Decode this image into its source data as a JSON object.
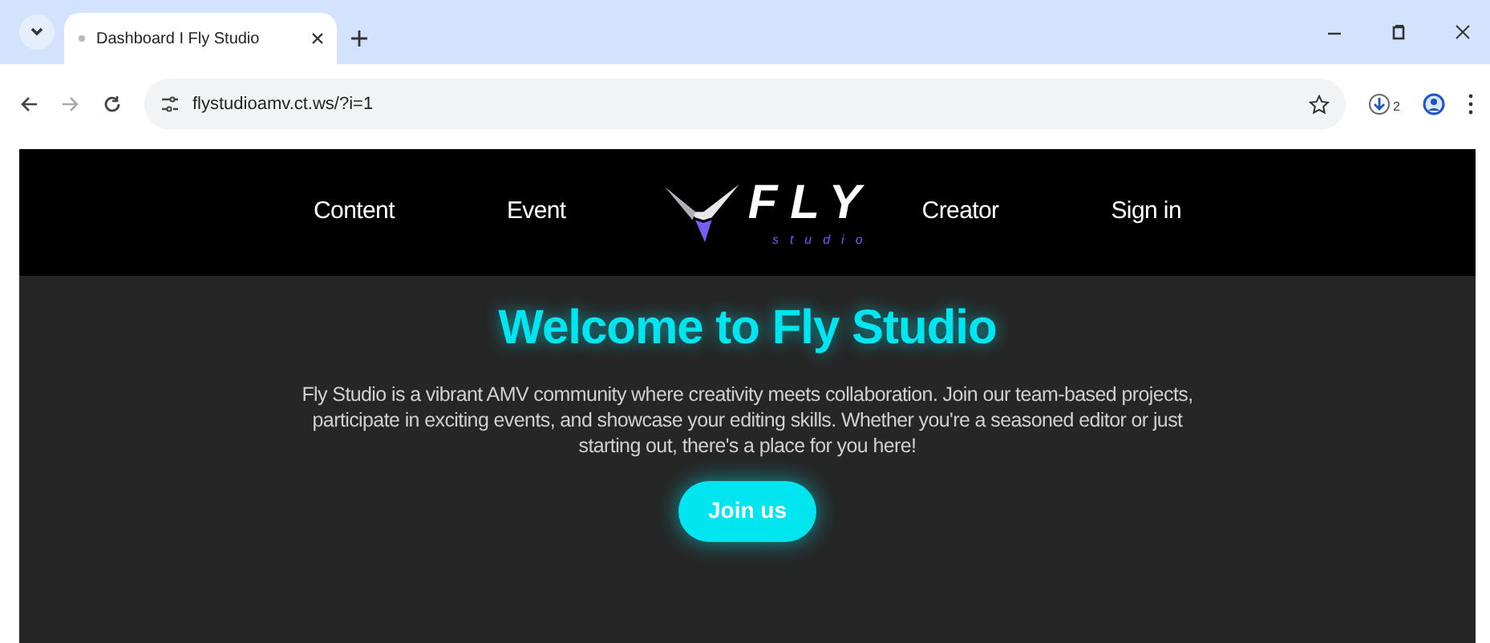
{
  "browser": {
    "tab": {
      "title": "Dashboard I Fly Studio",
      "selected": true
    },
    "url": "flystudioamv.ct.ws/?i=1",
    "downloads_badge": "2"
  },
  "nav": {
    "left": [
      "Content",
      "Event"
    ],
    "logo": {
      "title": "FLY",
      "subtitle": "studio"
    },
    "right": [
      "Creator",
      "Sign in"
    ]
  },
  "hero": {
    "title": "Welcome to Fly Studio",
    "text": "Fly Studio is a vibrant AMV community where creativity meets collaboration. Join our team-based projects, participate in exciting events, and showcase your editing skills. Whether you're a seasoned editor or just starting out, there's a place for you here!",
    "button": "Join us"
  }
}
